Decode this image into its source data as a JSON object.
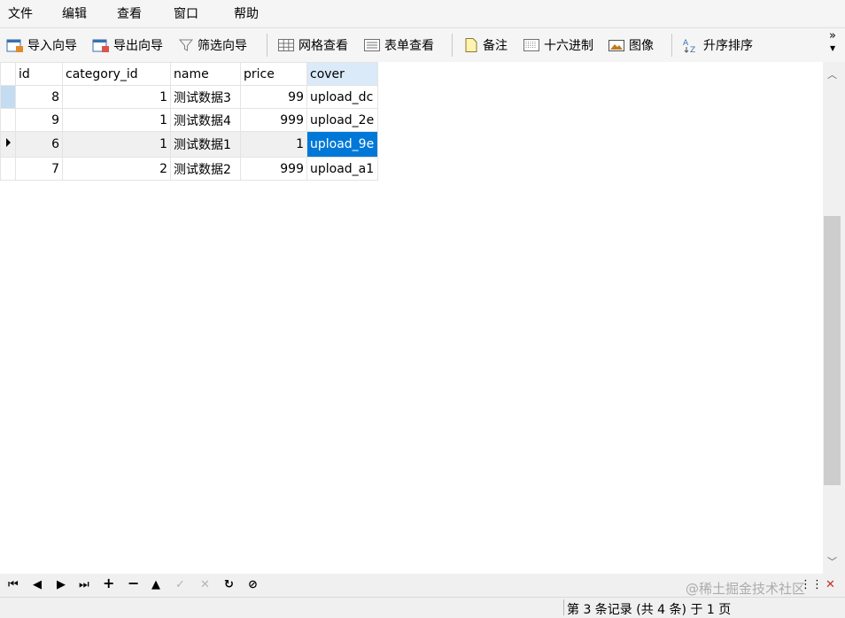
{
  "menu": [
    "文件",
    "编辑",
    "查看",
    "窗口",
    "帮助"
  ],
  "toolbar": {
    "import": "导入向导",
    "export": "导出向导",
    "filter": "筛选向导",
    "grid_view": "网格查看",
    "form_view": "表单查看",
    "memo": "备注",
    "hex": "十六进制",
    "image": "图像",
    "sort": "升序排序",
    "more": "»"
  },
  "table": {
    "columns": [
      "id",
      "category_id",
      "name",
      "price",
      "cover"
    ],
    "rows": [
      {
        "id": "8",
        "category_id": "1",
        "name": "测试数据3",
        "price": "99",
        "cover": "upload_dc"
      },
      {
        "id": "9",
        "category_id": "1",
        "name": "测试数据4",
        "price": "999",
        "cover": "upload_2e"
      },
      {
        "id": "6",
        "category_id": "1",
        "name": "测试数据1",
        "price": "1",
        "cover": "upload_9e"
      },
      {
        "id": "7",
        "category_id": "2",
        "name": "测试数据2",
        "price": "999",
        "cover": "upload_a1"
      }
    ]
  },
  "status": "第 3 条记录 (共 4 条) 于 1 页",
  "watermark": "@稀土掘金技术社区",
  "colors": {
    "selection": "#0078d7",
    "header_highlight": "#dbeaf8"
  }
}
